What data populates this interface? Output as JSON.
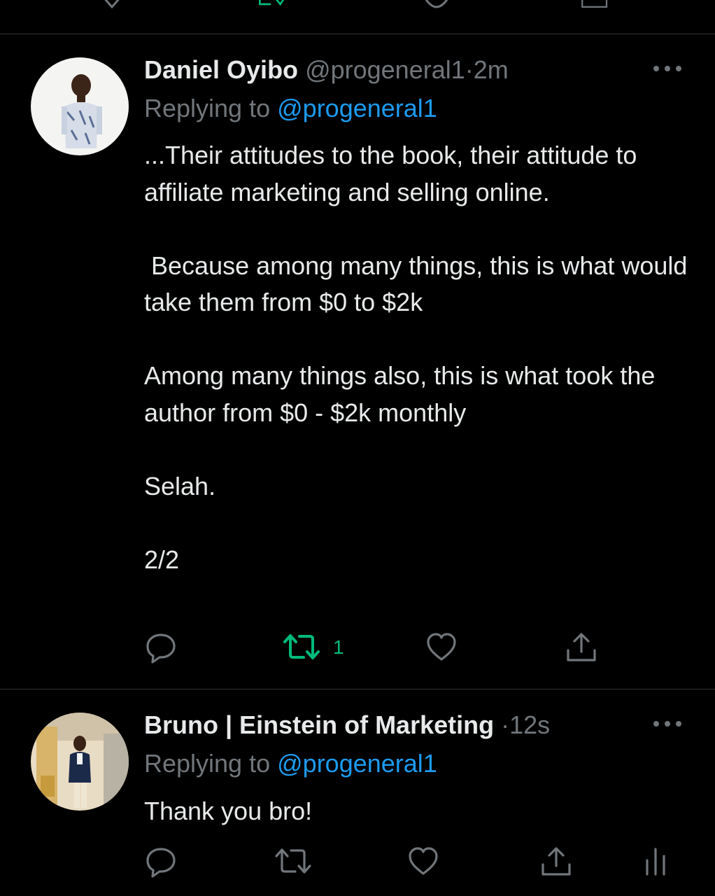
{
  "colors": {
    "background": "#000000",
    "text": "#e7e9ea",
    "muted": "#71767b",
    "link": "#1d9bf0",
    "retweet_active": "#00ba7c",
    "divider": "#2f3336"
  },
  "tweets": [
    {
      "name": "Daniel Oyibo",
      "handle": "@progeneral1",
      "separator": "·",
      "time": "2m",
      "replying_prefix": "Replying to",
      "replying_handle": "@progeneral1",
      "text": "...Their attitudes to the book, their attitude to affiliate marketing and selling online.\n\n Because among many things, this is what would take them from $0 to $2k\n\nAmong many things also, this is what took the author from $0 - $2k monthly\n\nSelah.\n\n2/2",
      "retweet_count": "1",
      "retweeted": true,
      "icons": [
        "more-icon",
        "reply-icon",
        "retweet-icon",
        "like-icon",
        "share-icon"
      ]
    },
    {
      "name": "Bruno | Einstein of Marketing",
      "separator": "·",
      "time": "12s",
      "replying_prefix": "Replying to",
      "replying_handle": "@progeneral1",
      "text": "Thank you bro!",
      "icons": [
        "more-icon",
        "reply-icon",
        "retweet-icon",
        "like-icon",
        "share-icon",
        "analytics-icon"
      ]
    }
  ]
}
